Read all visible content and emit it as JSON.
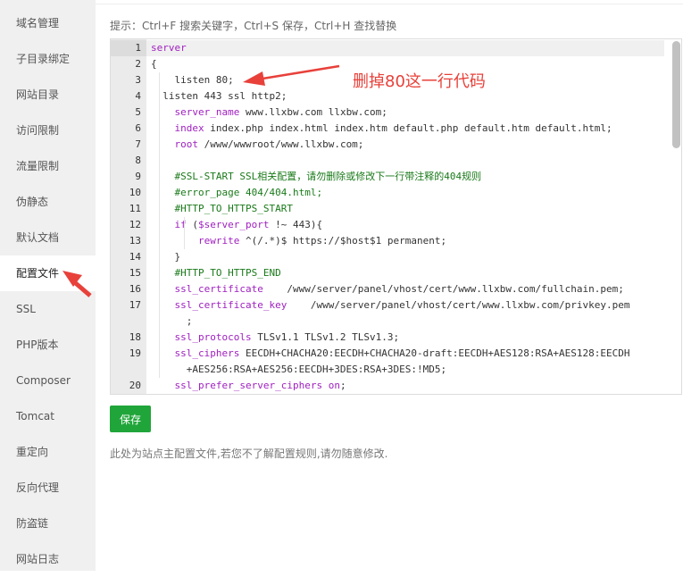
{
  "sidebar": {
    "items": [
      {
        "label": "域名管理"
      },
      {
        "label": "子目录绑定"
      },
      {
        "label": "网站目录"
      },
      {
        "label": "访问限制"
      },
      {
        "label": "流量限制"
      },
      {
        "label": "伪静态"
      },
      {
        "label": "默认文档"
      },
      {
        "label": "配置文件",
        "active": true
      },
      {
        "label": "SSL"
      },
      {
        "label": "PHP版本"
      },
      {
        "label": "Composer"
      },
      {
        "label": "Tomcat"
      },
      {
        "label": "重定向"
      },
      {
        "label": "反向代理"
      },
      {
        "label": "防盗链"
      },
      {
        "label": "网站日志"
      }
    ]
  },
  "hint": "提示：Ctrl+F 搜索关键字，Ctrl+S 保存，Ctrl+H 查找替换",
  "editor": {
    "line_numbers": [
      "1",
      "2",
      "3",
      "4",
      "5",
      "6",
      "7",
      "8",
      "9",
      "10",
      "11",
      "12",
      "13",
      "14",
      "15",
      "16",
      "17",
      "18",
      "19",
      "20"
    ],
    "lines": [
      {
        "no": "1",
        "parts": [
          [
            "kw",
            "server"
          ]
        ]
      },
      {
        "no": "2",
        "parts": [
          [
            "t",
            "{"
          ]
        ]
      },
      {
        "no": "3",
        "parts": [
          [
            "t",
            "    listen 80;"
          ]
        ]
      },
      {
        "no": "4",
        "parts": [
          [
            "t",
            "  listen 443 ssl http2;"
          ]
        ]
      },
      {
        "no": "5",
        "parts": [
          [
            "t",
            "    "
          ],
          [
            "kw",
            "server_name"
          ],
          [
            "t",
            " www.llxbw.com llxbw.com;"
          ]
        ]
      },
      {
        "no": "6",
        "parts": [
          [
            "t",
            "    "
          ],
          [
            "kw",
            "index"
          ],
          [
            "t",
            " index.php index.html index.htm default.php default.htm default.html;"
          ]
        ]
      },
      {
        "no": "7",
        "parts": [
          [
            "t",
            "    "
          ],
          [
            "kw",
            "root"
          ],
          [
            "t",
            " /www/wwwroot/www.llxbw.com;"
          ]
        ]
      },
      {
        "no": "8",
        "parts": [
          [
            "t",
            ""
          ]
        ]
      },
      {
        "no": "9",
        "parts": [
          [
            "t",
            "    "
          ],
          [
            "cm",
            "#SSL-START SSL相关配置，请勿删除或修改下一行带注释的404规则"
          ]
        ]
      },
      {
        "no": "10",
        "parts": [
          [
            "t",
            "    "
          ],
          [
            "cm",
            "#error_page 404/404.html;"
          ]
        ]
      },
      {
        "no": "11",
        "parts": [
          [
            "t",
            "    "
          ],
          [
            "cm",
            "#HTTP_TO_HTTPS_START"
          ]
        ]
      },
      {
        "no": "12",
        "parts": [
          [
            "t",
            "    "
          ],
          [
            "kw",
            "if"
          ],
          [
            "t",
            " ("
          ],
          [
            "var",
            "$server_port"
          ],
          [
            "t",
            " !~ 443){"
          ]
        ]
      },
      {
        "no": "13",
        "parts": [
          [
            "t",
            "        "
          ],
          [
            "kw",
            "rewrite"
          ],
          [
            "t",
            " ^(/.*)$ https://$host$1 permanent;"
          ]
        ]
      },
      {
        "no": "14",
        "parts": [
          [
            "t",
            "    }"
          ]
        ]
      },
      {
        "no": "15",
        "parts": [
          [
            "t",
            "    "
          ],
          [
            "cm",
            "#HTTP_TO_HTTPS_END"
          ]
        ]
      },
      {
        "no": "16",
        "parts": [
          [
            "t",
            "    "
          ],
          [
            "kw",
            "ssl_certificate"
          ],
          [
            "t",
            "    /www/server/panel/vhost/cert/www.llxbw.com/fullchain.pem;"
          ]
        ]
      },
      {
        "no": "17",
        "parts": [
          [
            "t",
            "    "
          ],
          [
            "kw",
            "ssl_certificate_key"
          ],
          [
            "t",
            "    /www/server/panel/vhost/cert/www.llxbw.com/privkey.pem"
          ]
        ]
      },
      {
        "no": "",
        "parts": [
          [
            "t",
            "      ;"
          ]
        ]
      },
      {
        "no": "18",
        "parts": [
          [
            "t",
            "    "
          ],
          [
            "kw",
            "ssl_protocols"
          ],
          [
            "t",
            " TLSv1.1 TLSv1.2 TLSv1.3;"
          ]
        ]
      },
      {
        "no": "19",
        "parts": [
          [
            "t",
            "    "
          ],
          [
            "kw",
            "ssl_ciphers"
          ],
          [
            "t",
            " EECDH+CHACHA20:EECDH+CHACHA20-draft:EECDH+AES128:RSA+AES128:EECDH"
          ]
        ]
      },
      {
        "no": "",
        "parts": [
          [
            "t",
            "      +AES256:RSA+AES256:EECDH+3DES:RSA+3DES:!MD5;"
          ]
        ]
      },
      {
        "no": "20",
        "parts": [
          [
            "t",
            "    "
          ],
          [
            "kw",
            "ssl_prefer_server_ciphers"
          ],
          [
            "t",
            " "
          ],
          [
            "kw",
            "on"
          ],
          [
            "t",
            ";"
          ]
        ]
      }
    ]
  },
  "save_label": "保存",
  "note": "此处为站点主配置文件,若您不了解配置规则,请勿随意修改.",
  "annotation": "删掉80这一行代码",
  "colors": {
    "accent_green": "#20a53a",
    "annotation_red": "#e8413a",
    "keyword": "#a020c0",
    "comment": "#1a7a1a"
  }
}
